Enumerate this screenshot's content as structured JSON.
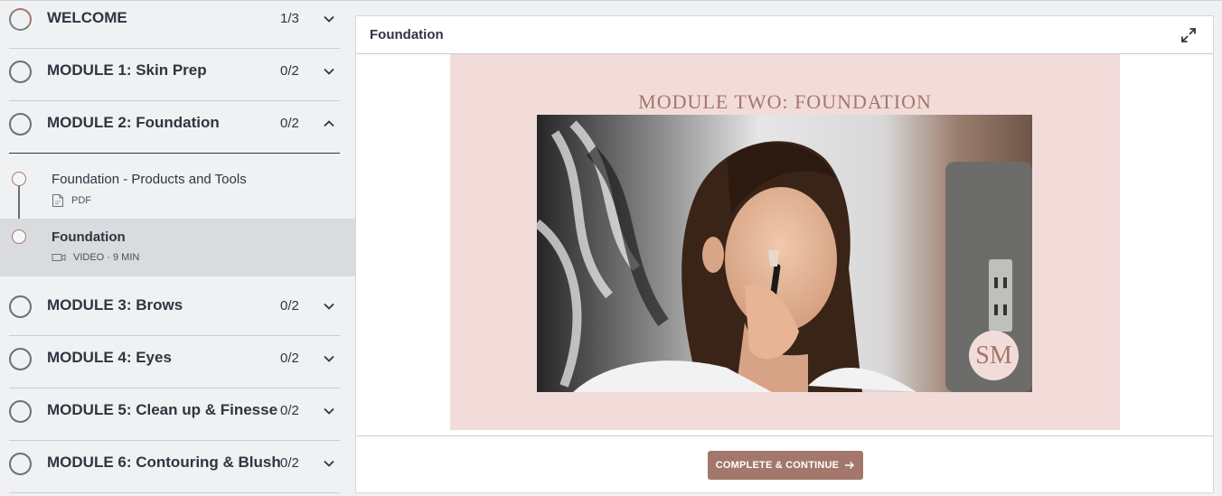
{
  "sidebar": {
    "modules": [
      {
        "title": "WELCOME",
        "count": "1/3",
        "expanded": false
      },
      {
        "title": "MODULE 1: Skin Prep",
        "count": "0/2",
        "expanded": false
      },
      {
        "title": "MODULE 2: Foundation",
        "count": "0/2",
        "expanded": true
      },
      {
        "title": "MODULE 3: Brows",
        "count": "0/2",
        "expanded": false
      },
      {
        "title": "MODULE 4: Eyes",
        "count": "0/2",
        "expanded": false
      },
      {
        "title": "MODULE 5: Clean up & Finesse",
        "count": "0/2",
        "expanded": false
      },
      {
        "title": "MODULE 6: Contouring & Blush",
        "count": "0/2",
        "expanded": false
      }
    ],
    "lessons": [
      {
        "title": "Foundation - Products and Tools",
        "type_label": "PDF",
        "icon": "pdf-icon",
        "active": false
      },
      {
        "title": "Foundation",
        "type_label": "VIDEO · 9 MIN",
        "icon": "video-icon",
        "active": true
      }
    ]
  },
  "main": {
    "title": "Foundation",
    "slide_title": "MODULE TWO: FOUNDATION",
    "badge_text": "SM",
    "cta_label": "COMPLETE & CONTINUE",
    "cta_icon": "arrow-right-icon",
    "expand_icon": "expand-icon"
  },
  "colors": {
    "accent": "#a3776b",
    "slide_background": "#f2dcda",
    "sidebar_background": "#f0f1f3",
    "active_lesson_background": "#d9dbde"
  }
}
